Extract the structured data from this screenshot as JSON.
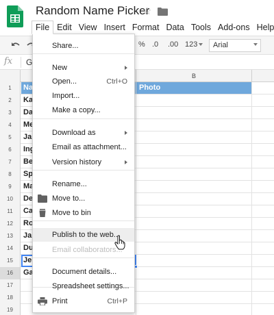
{
  "app": {
    "title": "Random Name Picker",
    "accent_color": "#0f9d58"
  },
  "menubar": {
    "items": [
      "File",
      "Edit",
      "View",
      "Insert",
      "Format",
      "Data",
      "Tools",
      "Add-ons",
      "Help"
    ],
    "active": "File"
  },
  "toolbar": {
    "undo_icon": "undo-icon",
    "redo_icon": "redo-icon",
    "percent": "%",
    "decrease_decimals": ".0",
    "increase_decimals": ".00",
    "more_formats": "123",
    "font": "Arial"
  },
  "formula_bar": {
    "fx": "fx",
    "content": "G"
  },
  "grid": {
    "column_b_label": "B",
    "rows": [
      {
        "num": "1",
        "a": "Na",
        "b": "Photo"
      },
      {
        "num": "2",
        "a": "Ka",
        "b": ""
      },
      {
        "num": "3",
        "a": "Da",
        "b": ""
      },
      {
        "num": "4",
        "a": "Me",
        "b": ""
      },
      {
        "num": "5",
        "a": "Ja",
        "b": ""
      },
      {
        "num": "6",
        "a": "Ing",
        "b": ""
      },
      {
        "num": "7",
        "a": "Be",
        "b": ""
      },
      {
        "num": "8",
        "a": "Sp",
        "b": ""
      },
      {
        "num": "9",
        "a": "Ma",
        "b": ""
      },
      {
        "num": "10",
        "a": "De",
        "b": ""
      },
      {
        "num": "11",
        "a": "Ca",
        "b": ""
      },
      {
        "num": "12",
        "a": "Ro",
        "b": ""
      },
      {
        "num": "13",
        "a": "Ja",
        "b": ""
      },
      {
        "num": "14",
        "a": "Du",
        "b": ""
      },
      {
        "num": "15",
        "a": "Je",
        "b": ""
      },
      {
        "num": "16",
        "a": "Ga",
        "b": ""
      },
      {
        "num": "17",
        "a": "",
        "b": ""
      },
      {
        "num": "18",
        "a": "",
        "b": ""
      },
      {
        "num": "19",
        "a": "",
        "b": ""
      },
      {
        "num": "20",
        "a": "",
        "b": ""
      }
    ],
    "header_fill": "#6fa8dc",
    "selected_row": "16"
  },
  "file_menu": {
    "items": [
      {
        "label": "Share...",
        "shortcut": "",
        "submenu": false,
        "disabled": false,
        "icon": ""
      },
      {
        "label": "New",
        "shortcut": "",
        "submenu": true,
        "disabled": false,
        "icon": ""
      },
      {
        "label": "Open...",
        "shortcut": "Ctrl+O",
        "submenu": false,
        "disabled": false,
        "icon": ""
      },
      {
        "label": "Import...",
        "shortcut": "",
        "submenu": false,
        "disabled": false,
        "icon": ""
      },
      {
        "label": "Make a copy...",
        "shortcut": "",
        "submenu": false,
        "disabled": false,
        "icon": ""
      },
      {
        "label": "Download as",
        "shortcut": "",
        "submenu": true,
        "disabled": false,
        "icon": ""
      },
      {
        "label": "Email as attachment...",
        "shortcut": "",
        "submenu": false,
        "disabled": false,
        "icon": ""
      },
      {
        "label": "Version history",
        "shortcut": "",
        "submenu": true,
        "disabled": false,
        "icon": ""
      },
      {
        "label": "Rename...",
        "shortcut": "",
        "submenu": false,
        "disabled": false,
        "icon": ""
      },
      {
        "label": "Move to...",
        "shortcut": "",
        "submenu": false,
        "disabled": false,
        "icon": "folder-icon"
      },
      {
        "label": "Move to bin",
        "shortcut": "",
        "submenu": false,
        "disabled": false,
        "icon": "trash-icon"
      },
      {
        "label": "Publish to the web...",
        "shortcut": "",
        "submenu": false,
        "disabled": false,
        "icon": "",
        "hovered": true
      },
      {
        "label": "Email collaborators...",
        "shortcut": "",
        "submenu": false,
        "disabled": true,
        "icon": ""
      },
      {
        "label": "Document details...",
        "shortcut": "",
        "submenu": false,
        "disabled": false,
        "icon": ""
      },
      {
        "label": "Spreadsheet settings...",
        "shortcut": "",
        "submenu": false,
        "disabled": false,
        "icon": ""
      },
      {
        "label": "Print",
        "shortcut": "Ctrl+P",
        "submenu": false,
        "disabled": false,
        "icon": "print-icon"
      }
    ]
  }
}
